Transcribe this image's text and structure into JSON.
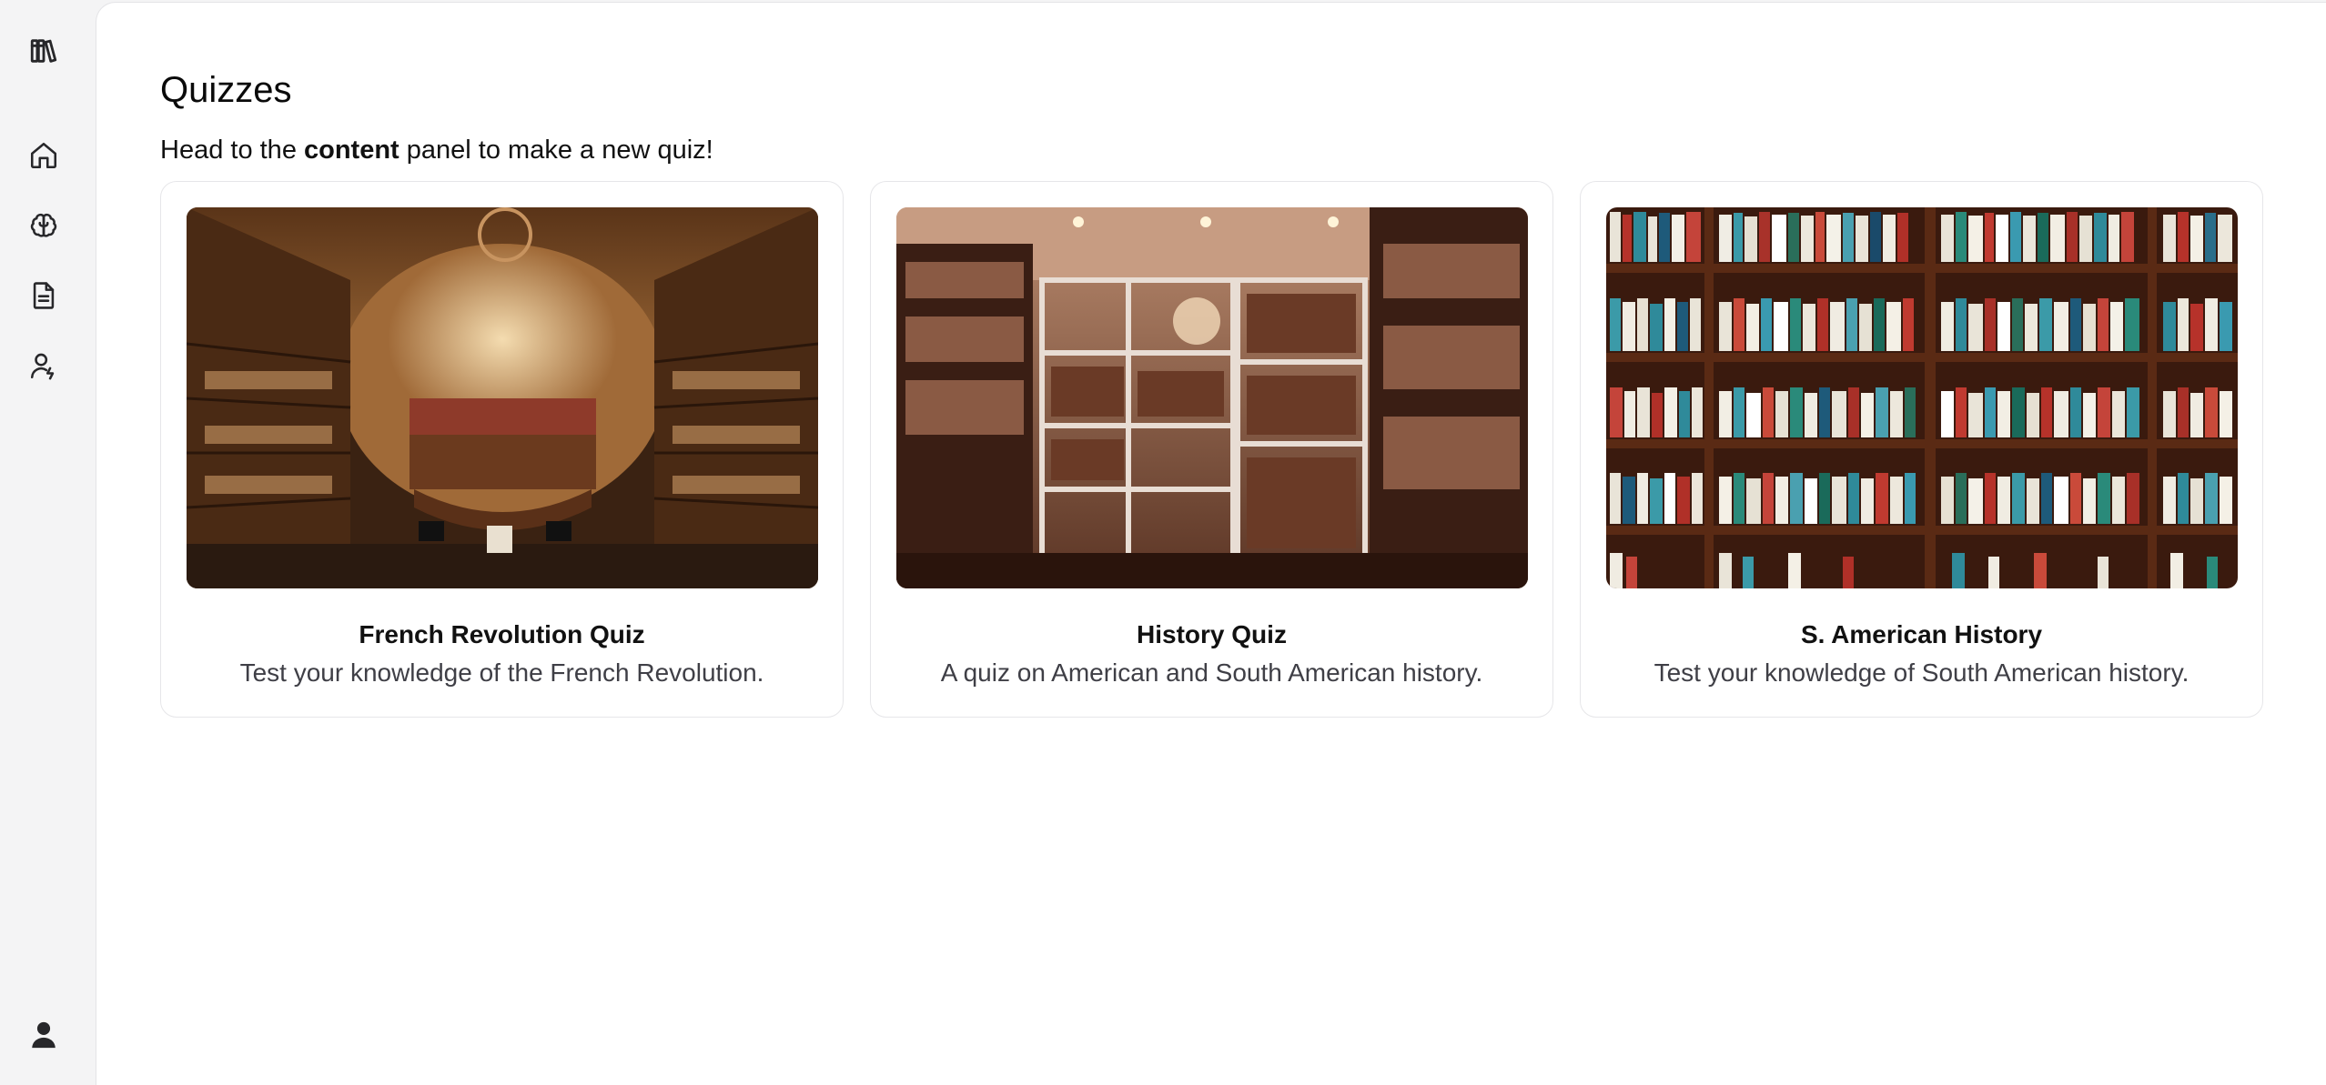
{
  "sidebar": {
    "items": [
      {
        "icon": "library-icon",
        "label": ""
      },
      {
        "icon": "home-icon",
        "label": ""
      },
      {
        "icon": "brain-icon",
        "label": ""
      },
      {
        "icon": "document-icon",
        "label": ""
      },
      {
        "icon": "user-cog-icon",
        "label": ""
      }
    ],
    "profile_icon": "user-icon"
  },
  "main": {
    "title": "Quizzes",
    "subtitle_before": "Head to the ",
    "subtitle_bold": "content",
    "subtitle_after": " panel to make a new quiz!"
  },
  "quizzes": [
    {
      "title": "French Revolution Quiz",
      "description": "Test your knowledge of the French Revolution.",
      "image": "ornate-library-photo"
    },
    {
      "title": "History Quiz",
      "description": "A quiz on American and South American history.",
      "image": "study-room-bookshelves-photo"
    },
    {
      "title": "S. American History",
      "description": "Test your knowledge of South American history.",
      "image": "bookshelf-photo"
    }
  ],
  "colors": {
    "sidebar_bg": "#f4f4f5",
    "panel_bg": "#ffffff",
    "card_border": "#e6e6e9",
    "text_primary": "#111111",
    "text_secondary": "#3f3f46"
  }
}
